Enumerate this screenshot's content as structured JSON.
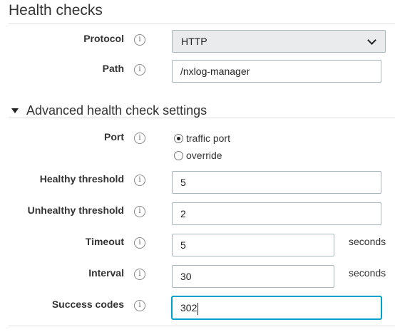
{
  "health_checks": {
    "title": "Health checks",
    "protocol": {
      "label": "Protocol",
      "info": "i",
      "value": "HTTP"
    },
    "path": {
      "label": "Path",
      "info": "i",
      "value": "/nxlog-manager"
    }
  },
  "advanced": {
    "title": "Advanced health check settings",
    "port": {
      "label": "Port",
      "info": "i",
      "options": [
        {
          "label": "traffic port",
          "selected": true
        },
        {
          "label": "override",
          "selected": false
        }
      ]
    },
    "healthy_threshold": {
      "label": "Healthy threshold",
      "info": "i",
      "value": "5"
    },
    "unhealthy_threshold": {
      "label": "Unhealthy threshold",
      "info": "i",
      "value": "2"
    },
    "timeout": {
      "label": "Timeout",
      "info": "i",
      "value": "5",
      "unit": "seconds"
    },
    "interval": {
      "label": "Interval",
      "info": "i",
      "value": "30",
      "unit": "seconds"
    },
    "success_codes": {
      "label": "Success codes",
      "info": "i",
      "value": "302"
    }
  },
  "colors": {
    "focus": "#00a1c9",
    "select_bg": "#e9ebed",
    "border": "#aab7b8"
  }
}
